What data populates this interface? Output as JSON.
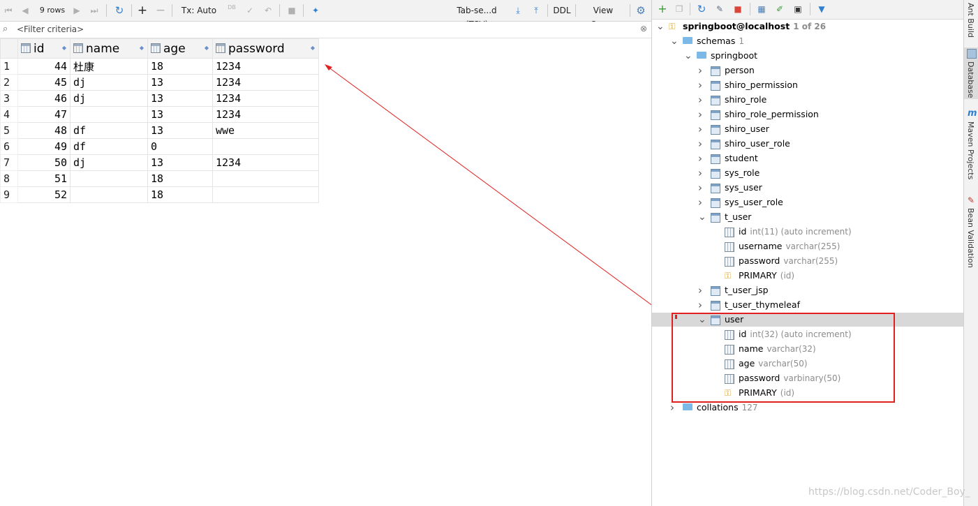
{
  "toolbar": {
    "rows": "9 rows",
    "tx": "Tx: Auto",
    "db": "DB",
    "export_format": "Tab-se...d (TSV)",
    "ddl": "DDL",
    "view_query": "View Query"
  },
  "filter": {
    "placeholder": "<Filter criteria>"
  },
  "grid": {
    "columns": [
      "id",
      "name",
      "age",
      "password"
    ],
    "rows": [
      {
        "n": "1",
        "id": "44",
        "name": "杜康",
        "age": "18",
        "password": "1234"
      },
      {
        "n": "2",
        "id": "45",
        "name": "dj",
        "age": "13",
        "password": "1234"
      },
      {
        "n": "3",
        "id": "46",
        "name": "dj",
        "age": "13",
        "password": "1234"
      },
      {
        "n": "4",
        "id": "47",
        "name": "",
        "age": "13",
        "password": "1234"
      },
      {
        "n": "5",
        "id": "48",
        "name": "df",
        "age": "13",
        "password": "wwe"
      },
      {
        "n": "6",
        "id": "49",
        "name": "df",
        "age": "0",
        "password": ""
      },
      {
        "n": "7",
        "id": "50",
        "name": "dj",
        "age": "13",
        "password": "1234"
      },
      {
        "n": "8",
        "id": "51",
        "name": "",
        "age": "18",
        "password": ""
      },
      {
        "n": "9",
        "id": "52",
        "name": "",
        "age": "18",
        "password": ""
      }
    ]
  },
  "tree": {
    "connection": "springboot@localhost",
    "connection_meta": "1 of 26",
    "schemas_label": "schemas",
    "schemas_count": "1",
    "schema": "springboot",
    "tables_before": [
      "person",
      "shiro_permission",
      "shiro_role",
      "shiro_role_permission",
      "shiro_user",
      "shiro_user_role",
      "student",
      "sys_role",
      "sys_user",
      "sys_user_role"
    ],
    "t_user": {
      "name": "t_user",
      "columns": [
        {
          "name": "id",
          "type": "int(11) (auto increment)"
        },
        {
          "name": "username",
          "type": "varchar(255)"
        },
        {
          "name": "password",
          "type": "varchar(255)"
        },
        {
          "name": "PRIMARY",
          "type": "(id)"
        }
      ]
    },
    "tables_mid": [
      "t_user_jsp",
      "t_user_thymeleaf"
    ],
    "user": {
      "name": "user",
      "columns": [
        {
          "name": "id",
          "type": "int(32) (auto increment)"
        },
        {
          "name": "name",
          "type": "varchar(32)"
        },
        {
          "name": "age",
          "type": "varchar(50)"
        },
        {
          "name": "password",
          "type": "varbinary(50)"
        },
        {
          "name": "PRIMARY",
          "type": "(id)"
        }
      ]
    },
    "collations_label": "collations",
    "collations_count": "127"
  },
  "side_tabs": [
    "Ant Build",
    "Database",
    "Maven Projects",
    "Bean Validation"
  ],
  "watermark": "https://blog.csdn.net/Coder_Boy_",
  "colors": {
    "annotation_red": "#e21f1f",
    "selection": "#d8d8d8"
  }
}
